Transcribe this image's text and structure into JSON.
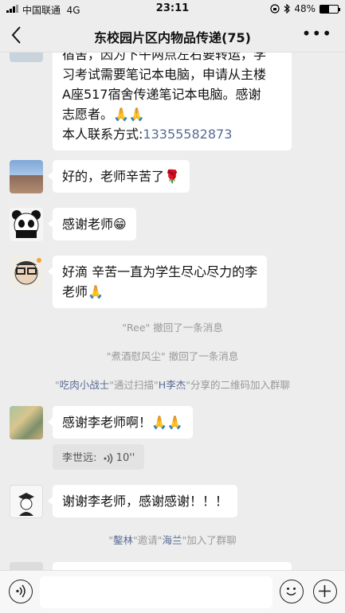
{
  "status_bar": {
    "carrier": "中国联通",
    "network": "4G",
    "time": "23:11",
    "battery": "48%",
    "battery_level": 0.48
  },
  "nav": {
    "title": "东校园片区内物品传递(75)"
  },
  "messages": {
    "m1": {
      "line1": "宿舍，因为下午两点左右要转运，学",
      "line2": "习考试需要笔记本电脑，申请从主楼",
      "line3": "A座517宿舍传递笔记本电脑。感谢",
      "line4": "志愿者。🙏🙏",
      "contact_label": "本人联系方式:",
      "phone": "13355582873"
    },
    "m2": {
      "text": "好的，老师辛苦了🌹"
    },
    "m3": {
      "text": "感谢老师😁"
    },
    "m4": {
      "line1": "好滴 辛苦一直为学生尽心尽力的李",
      "line2": "老师🙏"
    },
    "m5": {
      "text": "感谢李老师啊！🙏🙏"
    },
    "m6": {
      "text": "谢谢李老师，感谢感谢！！！"
    }
  },
  "system": {
    "s1": {
      "name": "\"Ree\"",
      "action": " 撤回了一条消息"
    },
    "s2": {
      "name": "\"煮酒慰风尘\"",
      "action": " 撤回了一条消息"
    },
    "s3": {
      "q1": "\"",
      "name1": "吃肉小战士",
      "mid1": "\"通过扫描\"",
      "name2": "H李杰",
      "mid2": "\"分享的二维码加入群聊"
    },
    "s4": {
      "q1": "\"",
      "name1": "鏊林",
      "mid1": "\"邀请\"",
      "name2": "海兰",
      "mid2": "\"加入了群聊"
    }
  },
  "voice": {
    "sender": "李世远:",
    "duration": "10''"
  },
  "icons": {
    "back": "chevron-left-icon",
    "more": "more-icon",
    "voice_toggle": "voice-icon",
    "emoji": "emoji-icon",
    "add": "plus-icon"
  }
}
